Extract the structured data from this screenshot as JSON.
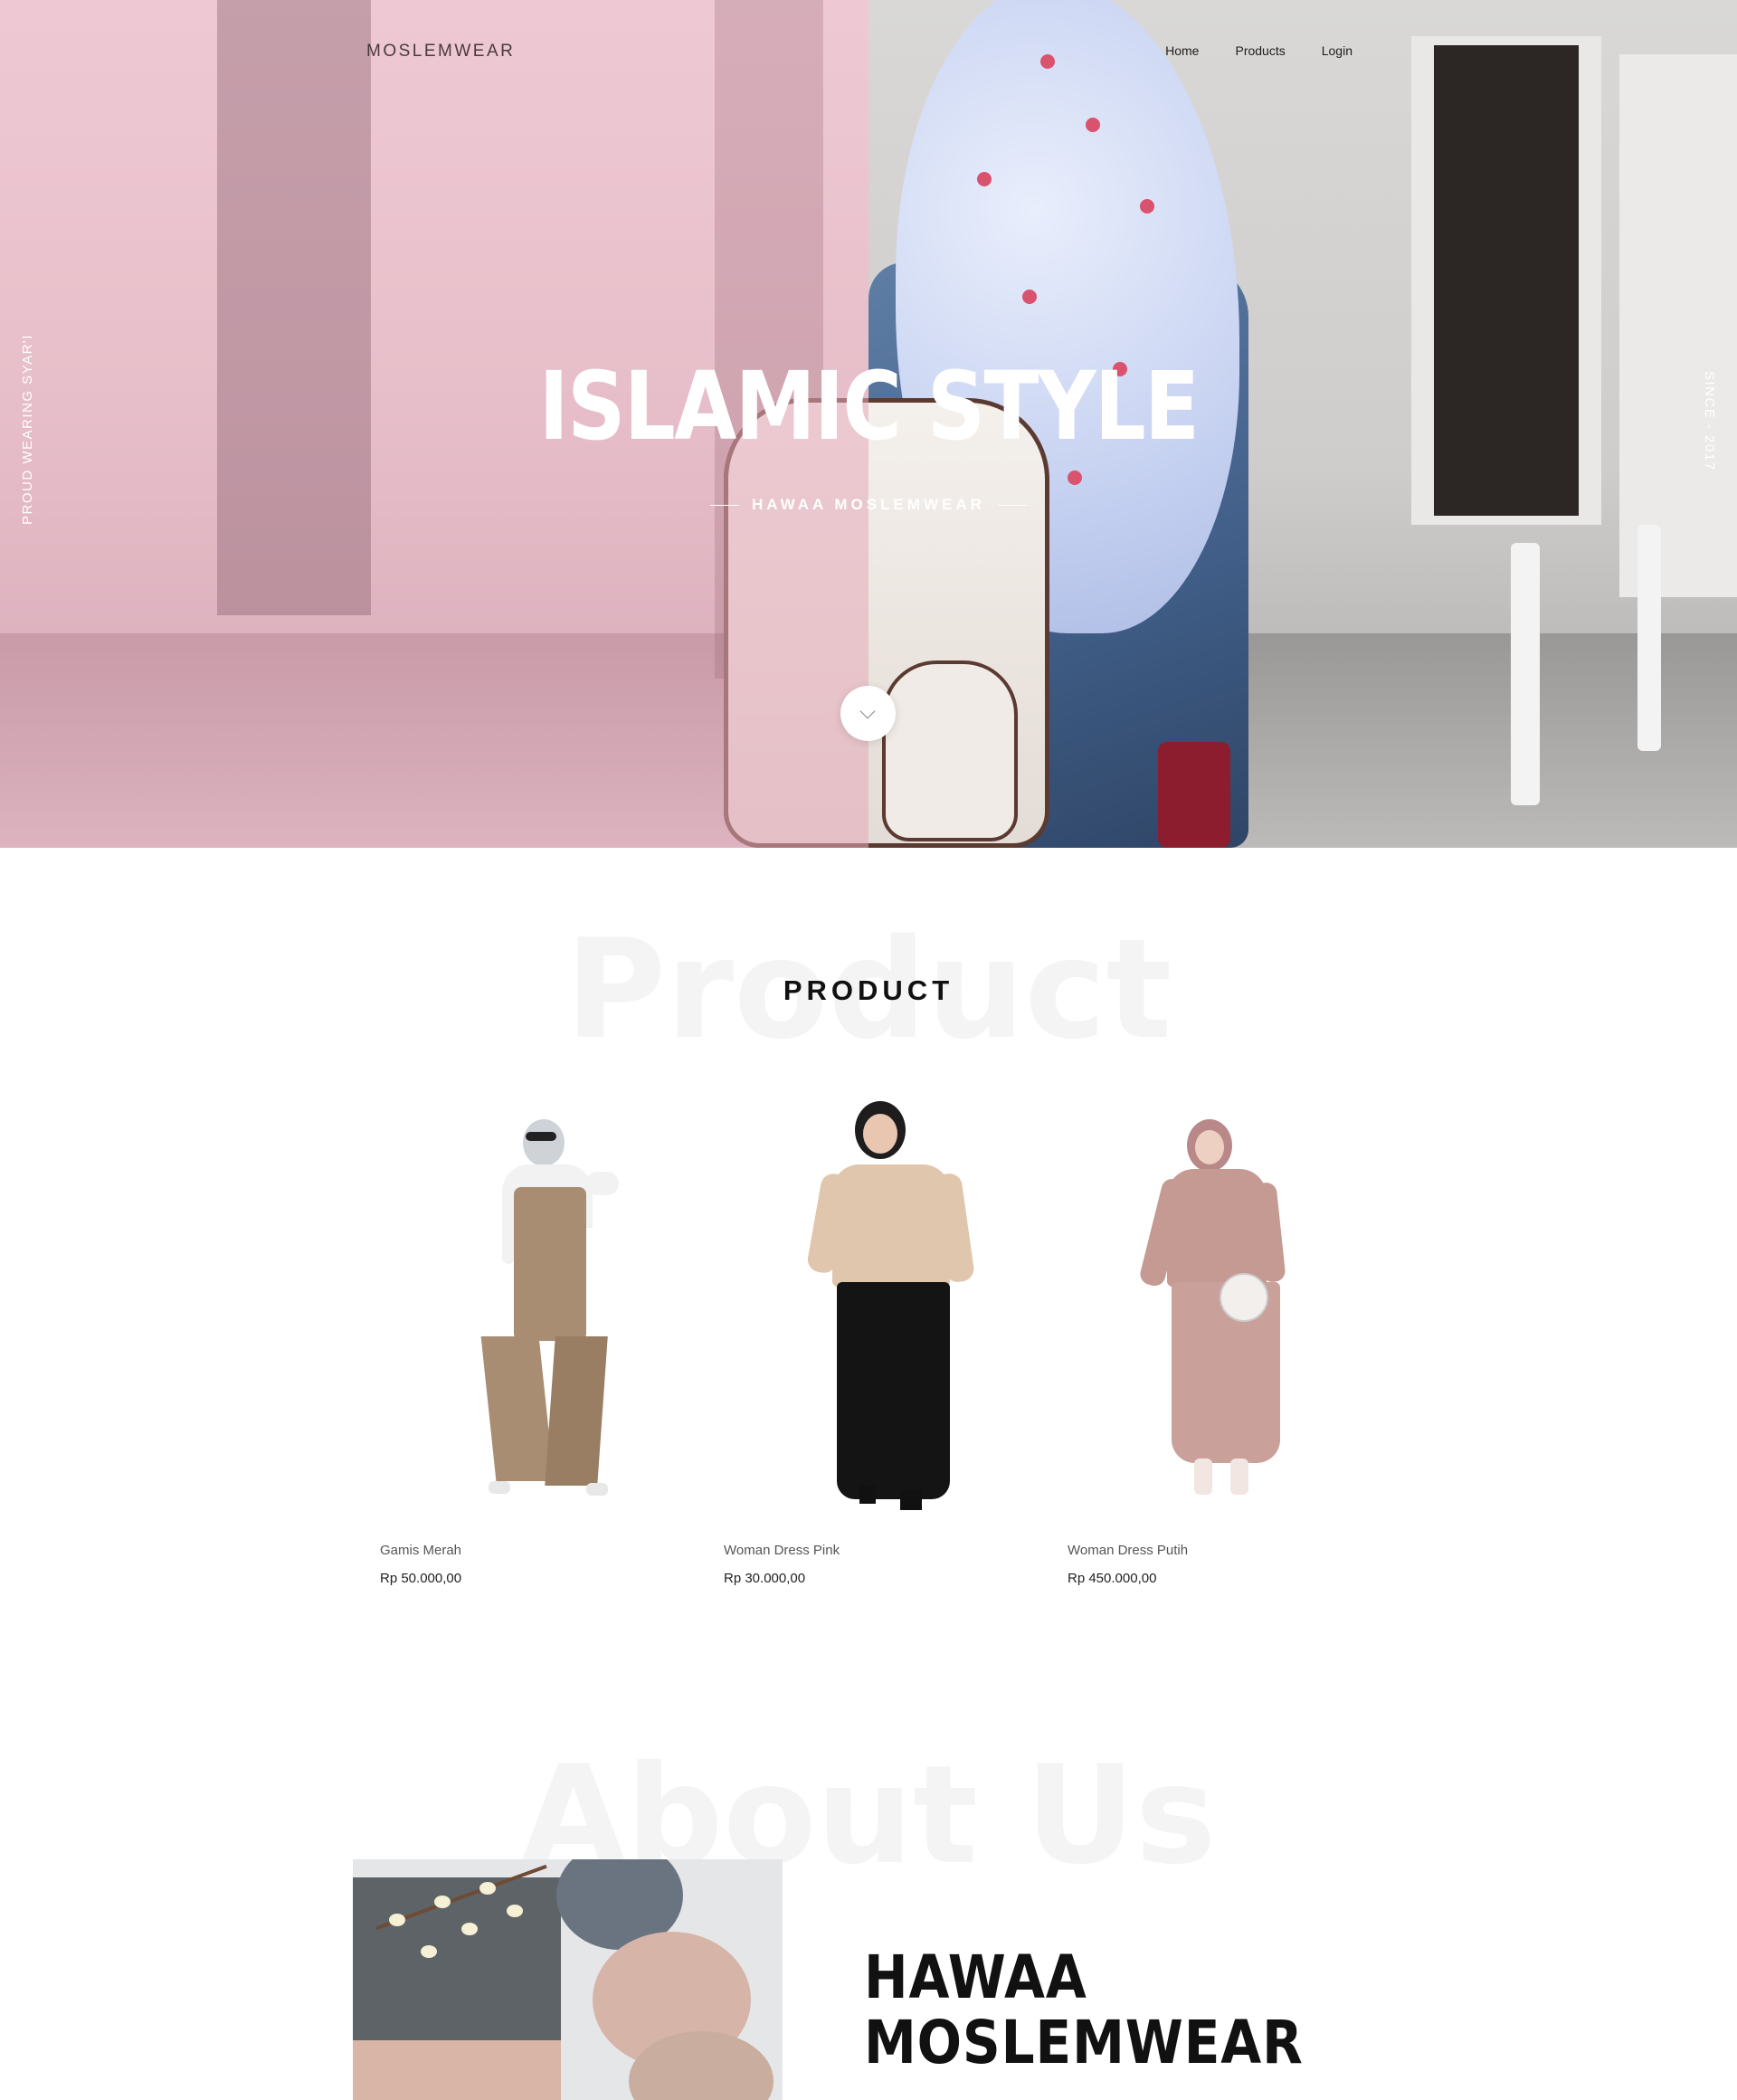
{
  "nav": {
    "brand": "MOSLEMWEAR",
    "links": [
      "Home",
      "Products",
      "Login"
    ]
  },
  "hero": {
    "side_left": "PROUD WEARING SYAR'I",
    "side_right": "SINCE - 2017",
    "title": "ISLAMIC STYLE",
    "subtitle": "HAWAA MOSLEMWEAR",
    "scroll_icon": "chevron-down-icon"
  },
  "products": {
    "watermark": "Product",
    "title": "PRODUCT",
    "items": [
      {
        "name": "Gamis Merah",
        "price": "Rp 50.000,00"
      },
      {
        "name": "Woman Dress Pink",
        "price": "Rp 30.000,00"
      },
      {
        "name": "Woman Dress Putih",
        "price": "Rp 450.000,00"
      }
    ]
  },
  "about": {
    "watermark": "About Us",
    "heading_line1": "HAWAA",
    "heading_line2": "MOSLEMWEAR"
  },
  "colors": {
    "hero_pink": "#eec9d3",
    "text_dark": "#111111",
    "watermark": "#f4f4f4"
  }
}
